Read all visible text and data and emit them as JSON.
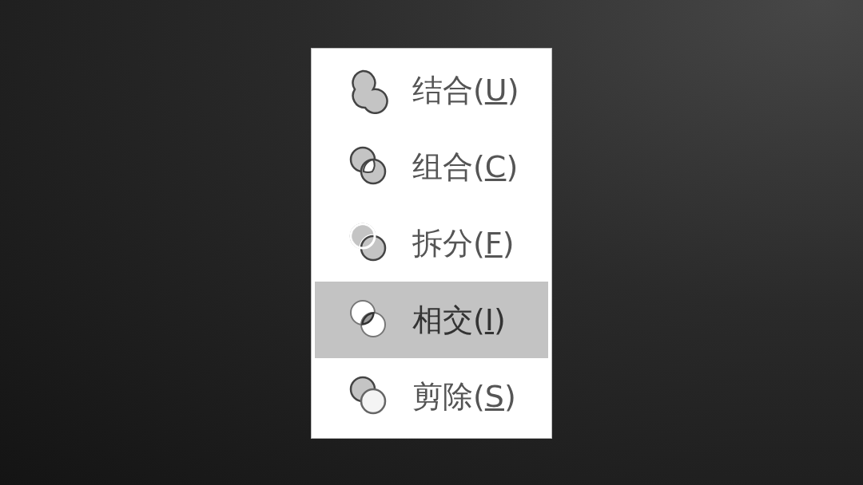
{
  "menu": {
    "items": [
      {
        "kind": "union",
        "text_before": "结合(",
        "access_key": "U",
        "text_after": ")",
        "selected": false
      },
      {
        "kind": "combine",
        "text_before": "组合(",
        "access_key": "C",
        "text_after": ")",
        "selected": false
      },
      {
        "kind": "fragment",
        "text_before": "拆分(",
        "access_key": "F",
        "text_after": ")",
        "selected": false
      },
      {
        "kind": "intersect",
        "text_before": "相交(",
        "access_key": "I",
        "text_after": ")",
        "selected": true
      },
      {
        "kind": "subtract",
        "text_before": "剪除(",
        "access_key": "S",
        "text_after": ")",
        "selected": false
      }
    ]
  }
}
